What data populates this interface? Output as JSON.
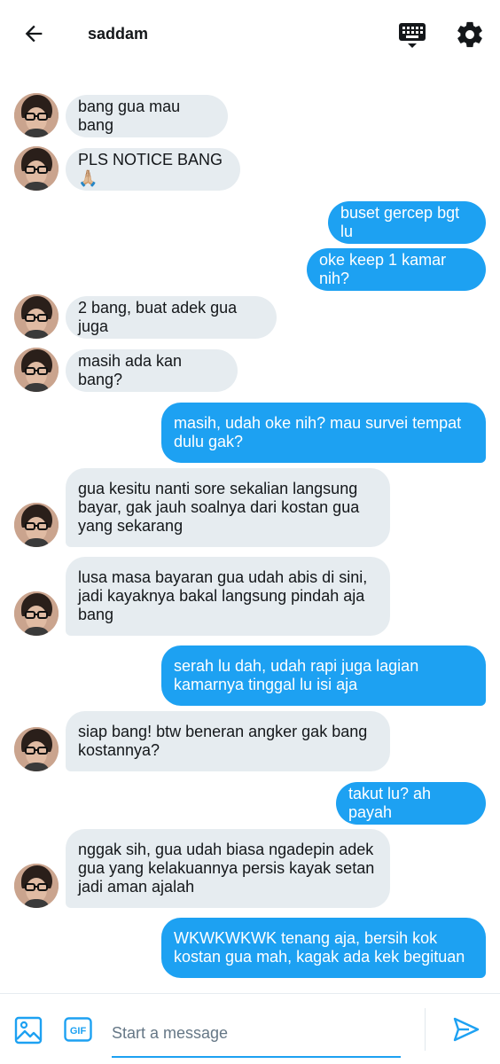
{
  "header": {
    "title": "saddam",
    "back_icon": "arrow-left-icon",
    "keyboard_icon": "keyboard-icon",
    "settings_icon": "gear-icon"
  },
  "colors": {
    "accent": "#1da1f2",
    "incoming_bubble": "#e6ecf0",
    "text": "#14171a",
    "placeholder": "#657786"
  },
  "messages": [
    {
      "sender": "them",
      "text": "bang gua mau bang"
    },
    {
      "sender": "them",
      "text": "PLS NOTICE BANG🙏🏼"
    },
    {
      "sender": "me",
      "text": "buset gercep bgt lu"
    },
    {
      "sender": "me",
      "text": "oke keep 1 kamar nih?"
    },
    {
      "sender": "them",
      "text": "2 bang, buat adek gua juga"
    },
    {
      "sender": "them",
      "text": "masih ada kan bang?"
    },
    {
      "sender": "me",
      "text": "masih, udah oke nih? mau survei tempat\ndulu gak?"
    },
    {
      "sender": "them",
      "text": "gua kesitu nanti sore sekalian langsung\nbayar, gak jauh soalnya dari kostan gua\nyang sekarang"
    },
    {
      "sender": "them",
      "text": "lusa masa bayaran gua udah abis di sini,\njadi kayaknya bakal langsung pindah aja\nbang"
    },
    {
      "sender": "me",
      "text": "serah lu dah, udah rapi juga lagian\nkamarnya tinggal lu isi aja"
    },
    {
      "sender": "them",
      "text": "siap bang! btw beneran angker gak bang\nkostannya?"
    },
    {
      "sender": "me",
      "text": "takut lu? ah payah"
    },
    {
      "sender": "them",
      "text": "nggak sih, gua udah biasa ngadepin adek\ngua yang kelakuannya persis kayak setan\njadi aman ajalah"
    },
    {
      "sender": "me",
      "text": "WKWKWKWK tenang aja, bersih kok\nkostan gua mah, kagak ada kek begituan"
    }
  ],
  "composer": {
    "placeholder": "Start a message",
    "value": "",
    "image_icon": "image-icon",
    "gif_icon": "gif-icon",
    "gif_label": "GIF",
    "send_icon": "send-icon"
  }
}
